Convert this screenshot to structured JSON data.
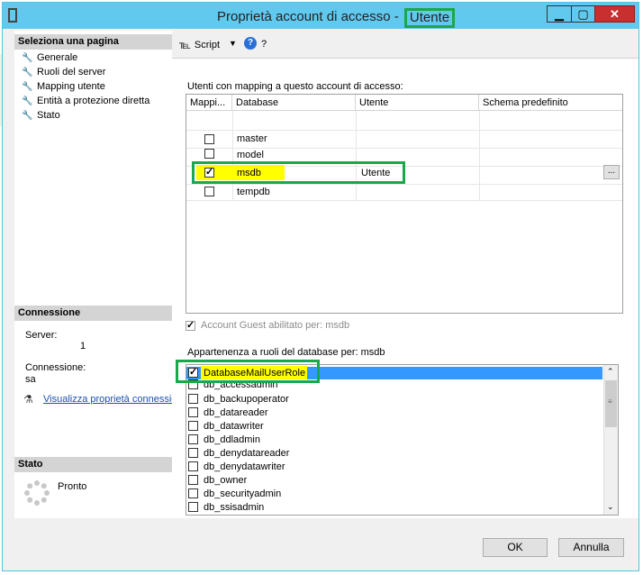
{
  "window": {
    "title": "Proprietà account di accesso -",
    "title_user": "Utente",
    "min": "▁",
    "max": "▢",
    "close": "✕"
  },
  "sidebar": {
    "header": "Seleziona una pagina",
    "items": [
      {
        "label": "Generale"
      },
      {
        "label": "Ruoli del server"
      },
      {
        "label": "Mapping utente"
      },
      {
        "label": "Entità a protezione diretta"
      },
      {
        "label": "Stato"
      }
    ]
  },
  "connection": {
    "header": "Connessione",
    "server_label": "Server:",
    "server_value": "1",
    "conn_label": "Connessione:",
    "conn_value": "sa",
    "link": "Visualizza proprietà connessione"
  },
  "status": {
    "header": "Stato",
    "value": "Pronto"
  },
  "toolbar": {
    "script_label": "Script",
    "help": "?"
  },
  "mapping": {
    "label": "Utenti con mapping a questo account di accesso:",
    "columns": [
      "Mappi...",
      "Database",
      "Utente",
      "Schema predefinito"
    ],
    "rows": [
      {
        "checked": false,
        "database": "master",
        "user": "",
        "schema": ""
      },
      {
        "checked": false,
        "database": "model",
        "user": "",
        "schema": ""
      },
      {
        "checked": true,
        "database": "msdb",
        "user": "Utente",
        "schema": ""
      },
      {
        "checked": false,
        "database": "tempdb",
        "user": "",
        "schema": ""
      }
    ],
    "ellipsis": "..."
  },
  "guest": {
    "label": "Account Guest abilitato per: msdb",
    "checked": true
  },
  "roles": {
    "label": "Appartenenza a ruoli del database per: msdb",
    "items": [
      {
        "name": "DatabaseMailUserRole",
        "checked": true
      },
      {
        "name": "db_accessadmin",
        "checked": false
      },
      {
        "name": "db_backupoperator",
        "checked": false
      },
      {
        "name": "db_datareader",
        "checked": false
      },
      {
        "name": "db_datawriter",
        "checked": false
      },
      {
        "name": "db_ddladmin",
        "checked": false
      },
      {
        "name": "db_denydatareader",
        "checked": false
      },
      {
        "name": "db_denydatawriter",
        "checked": false
      },
      {
        "name": "db_owner",
        "checked": false
      },
      {
        "name": "db_securityadmin",
        "checked": false
      },
      {
        "name": "db_ssisadmin",
        "checked": false
      }
    ]
  },
  "buttons": {
    "ok": "OK",
    "cancel": "Annulla"
  },
  "colors": {
    "titlebar": "#62c9ee",
    "highlight_green": "#1aa84a",
    "highlight_yellow": "#ffff00",
    "selection_blue": "#3399ff"
  }
}
